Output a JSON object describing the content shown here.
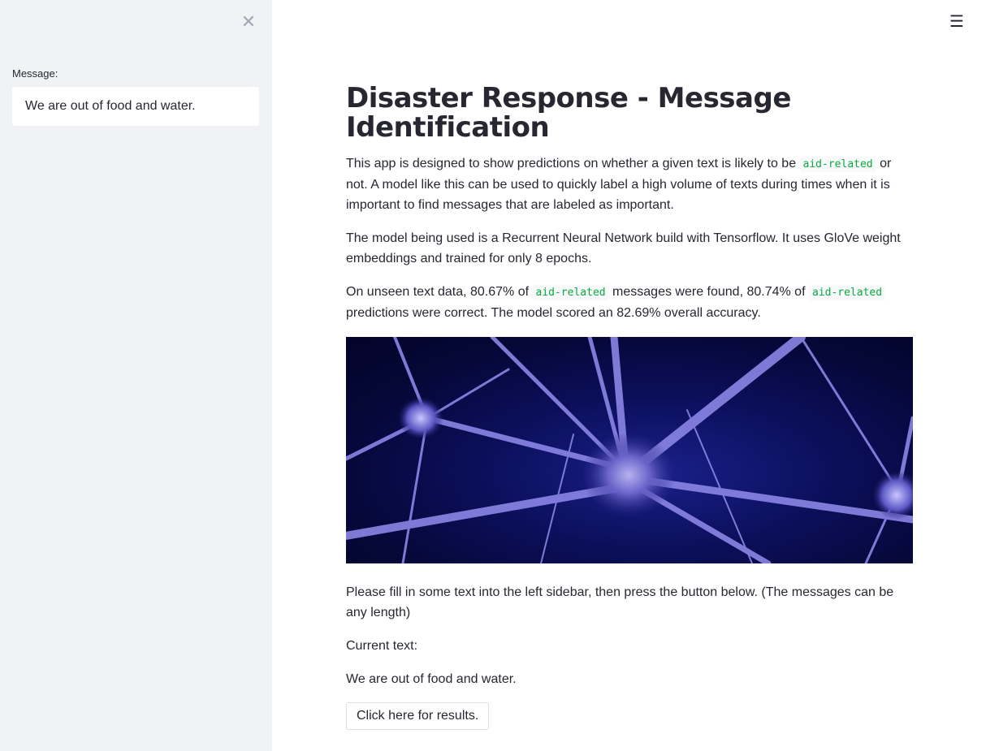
{
  "sidebar": {
    "close_icon": "close-icon",
    "message_label": "Message:",
    "message_value": "We are out of food and water."
  },
  "header": {
    "menu_icon": "hamburger-menu-icon"
  },
  "main": {
    "title": "Disaster Response - Message Identification",
    "para1": {
      "before": "This app is designed to show predictions on whether a given text is likely to be ",
      "code": "aid-related",
      "after": " or not. A model like this can be used to quickly label a high volume of texts during times when it is important to find messages that are labeled as important."
    },
    "para2": "The model being used is a Recurrent Neural Network build with Tensorflow. It uses GloVe weight embeddings and trained for only 8 epochs.",
    "para3": {
      "part1": "On unseen text data, 80.67% of ",
      "code1": "aid-related",
      "part2": " messages were found, 80.74% of ",
      "code2": "aid-related",
      "part3": " predictions were correct. The model scored an 82.69% overall accuracy."
    },
    "instructions": "Please fill in some text into the left sidebar, then press the button below. (The messages can be any length)",
    "current_text_label": "Current text:",
    "current_text_value": "We are out of food and water.",
    "results_button": "Click here for results."
  },
  "colors": {
    "sidebar_bg": "#f0f2f6",
    "code_green": "#09ab3b",
    "text": "#262730"
  }
}
